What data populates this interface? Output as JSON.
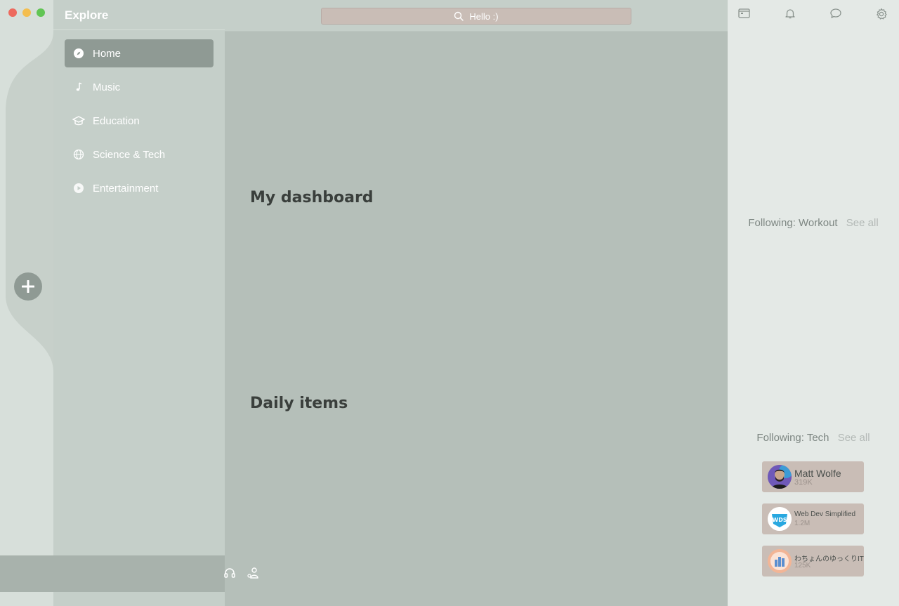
{
  "window": {
    "title": "Explore"
  },
  "sidebar": {
    "title": "Explore",
    "items": [
      {
        "label": "Home",
        "icon": "compass-icon",
        "active": true
      },
      {
        "label": "Music",
        "icon": "music-note-icon"
      },
      {
        "label": "Education",
        "icon": "graduation-cap-icon"
      },
      {
        "label": "Science & Tech",
        "icon": "globe-icon"
      },
      {
        "label": "Entertainment",
        "icon": "play-circle-icon"
      }
    ]
  },
  "search": {
    "placeholder": "Hello :)"
  },
  "main": {
    "sections": [
      {
        "title": "My dashboard"
      },
      {
        "title": "Daily items"
      }
    ]
  },
  "right_panel": {
    "toolbar_icons": [
      "window-icon",
      "bell-icon",
      "chat-bubble-icon",
      "gear-icon"
    ],
    "following_workout": {
      "label": "Following: Workout",
      "see_all": "See all"
    },
    "following_tech": {
      "label": "Following: Tech",
      "see_all": "See all",
      "channels": [
        {
          "name": "Matt Wolfe",
          "subscribers": "319K"
        },
        {
          "name": "Web Dev Simplified",
          "subscribers": "1.2M",
          "logo_text": "WDS"
        },
        {
          "name": "わちょんのゆっくりIT",
          "subscribers": "125K"
        }
      ]
    }
  },
  "colors": {
    "accent": "#8f9a94",
    "card": "#c9bdb6",
    "background": "#b5bfb9"
  }
}
